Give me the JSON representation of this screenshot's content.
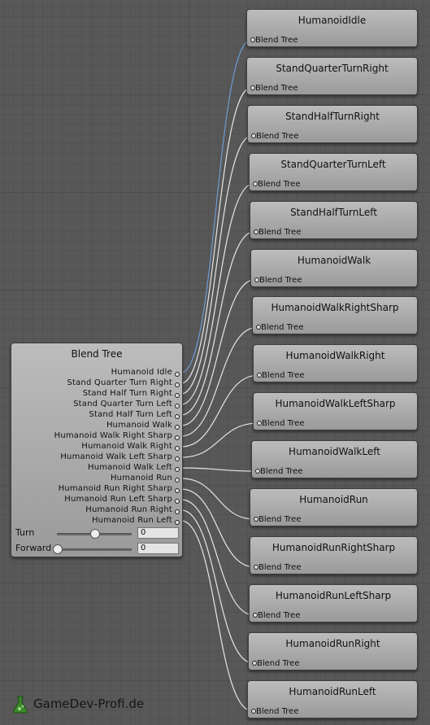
{
  "blend_tree": {
    "title": "Blend Tree",
    "outputs": [
      "Humanoid Idle",
      "Stand Quarter Turn Right",
      "Stand Half Turn Right",
      "Stand Quarter Turn Left",
      "Stand Half Turn Left",
      "Humanoid Walk",
      "Humanoid Walk Right Sharp",
      "Humanoid Walk Right",
      "Humanoid Walk Left Sharp",
      "Humanoid Walk Left",
      "Humanoid Run",
      "Humanoid Run Right Sharp",
      "Humanoid Run Left Sharp",
      "Humanoid Run Right",
      "Humanoid Run Left"
    ],
    "params": [
      {
        "name": "Turn",
        "value": "0",
        "slider": 0.5
      },
      {
        "name": "Forward",
        "value": "0",
        "slider": 0.0
      }
    ]
  },
  "motions": [
    {
      "title": "HumanoidIdle",
      "sub": "Blend Tree"
    },
    {
      "title": "StandQuarterTurnRight",
      "sub": "Blend Tree"
    },
    {
      "title": "StandHalfTurnRight",
      "sub": "Blend Tree"
    },
    {
      "title": "StandQuarterTurnLeft",
      "sub": "Blend Tree"
    },
    {
      "title": "StandHalfTurnLeft",
      "sub": "Blend Tree"
    },
    {
      "title": "HumanoidWalk",
      "sub": "Blend Tree"
    },
    {
      "title": "HumanoidWalkRightSharp",
      "sub": "Blend Tree"
    },
    {
      "title": "HumanoidWalkRight",
      "sub": "Blend Tree"
    },
    {
      "title": "HumanoidWalkLeftSharp",
      "sub": "Blend Tree"
    },
    {
      "title": "HumanoidWalkLeft",
      "sub": "Blend Tree"
    },
    {
      "title": "HumanoidRun",
      "sub": "Blend Tree"
    },
    {
      "title": "HumanoidRunRightSharp",
      "sub": "Blend Tree"
    },
    {
      "title": "HumanoidRunLeftSharp",
      "sub": "Blend Tree"
    },
    {
      "title": "HumanoidRunRight",
      "sub": "Blend Tree"
    },
    {
      "title": "HumanoidRunLeft",
      "sub": "Blend Tree"
    }
  ],
  "colors": {
    "wire": "#e6e6e6",
    "selected_wire": "#6f9bd1",
    "node_top": "#bcbcbc",
    "node_bottom": "#9a9a9a",
    "logo_green": "#3c8a2a"
  },
  "logo": {
    "text": "GameDev-Profi.de",
    "icon": "flask-icon"
  }
}
